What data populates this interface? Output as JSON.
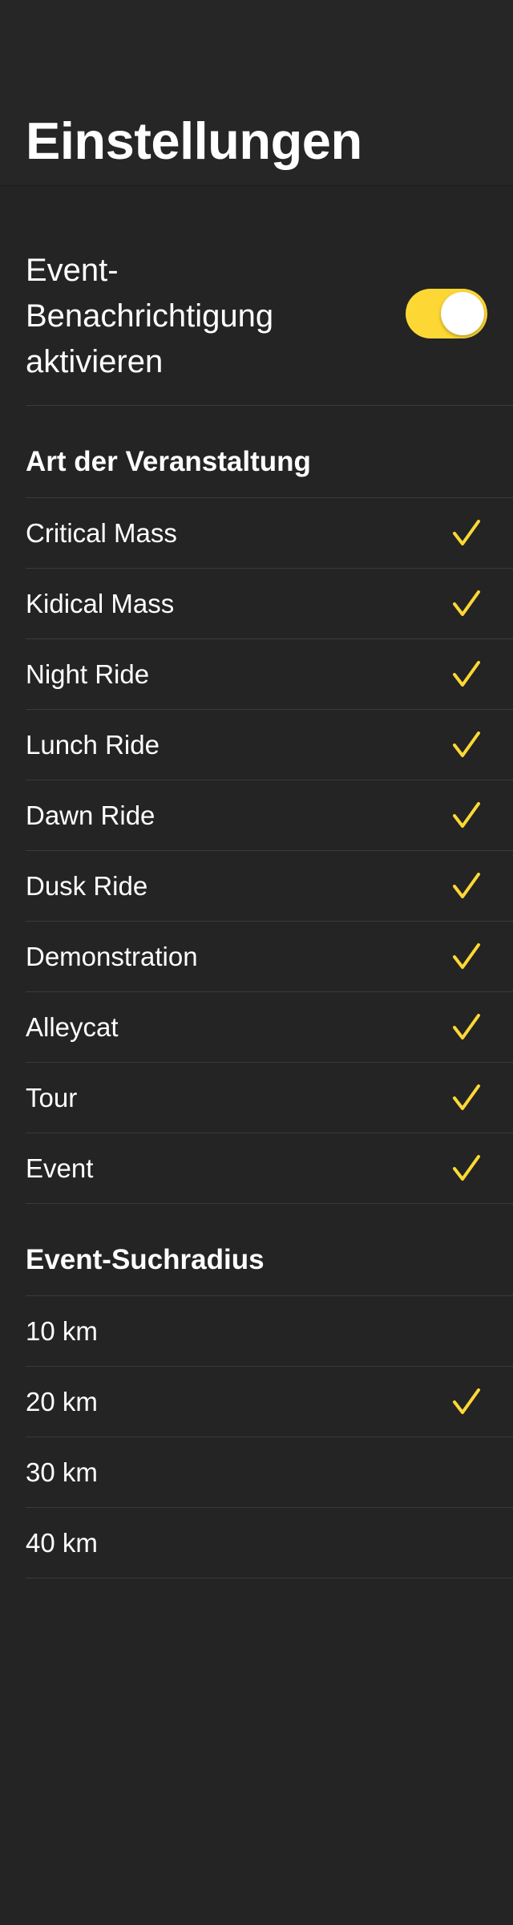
{
  "header": {
    "title": "Einstellungen"
  },
  "notification": {
    "label": "Event-\nBenachrichtigung aktivieren",
    "enabled": true
  },
  "event_types": {
    "title": "Art der Veranstaltung",
    "items": [
      {
        "label": "Critical Mass",
        "checked": true
      },
      {
        "label": "Kidical Mass",
        "checked": true
      },
      {
        "label": "Night Ride",
        "checked": true
      },
      {
        "label": "Lunch Ride",
        "checked": true
      },
      {
        "label": "Dawn Ride",
        "checked": true
      },
      {
        "label": "Dusk Ride",
        "checked": true
      },
      {
        "label": "Demonstration",
        "checked": true
      },
      {
        "label": "Alleycat",
        "checked": true
      },
      {
        "label": "Tour",
        "checked": true
      },
      {
        "label": "Event",
        "checked": true
      }
    ]
  },
  "radius": {
    "title": "Event-Suchradius",
    "items": [
      {
        "label": "10 km",
        "checked": false
      },
      {
        "label": "20 km",
        "checked": true
      },
      {
        "label": "30 km",
        "checked": false
      },
      {
        "label": "40 km",
        "checked": false
      }
    ]
  },
  "colors": {
    "accent": "#FDD835",
    "background": "#242424",
    "separator": "#3A3A3C"
  },
  "icons": {
    "check": "checkmark-icon"
  }
}
